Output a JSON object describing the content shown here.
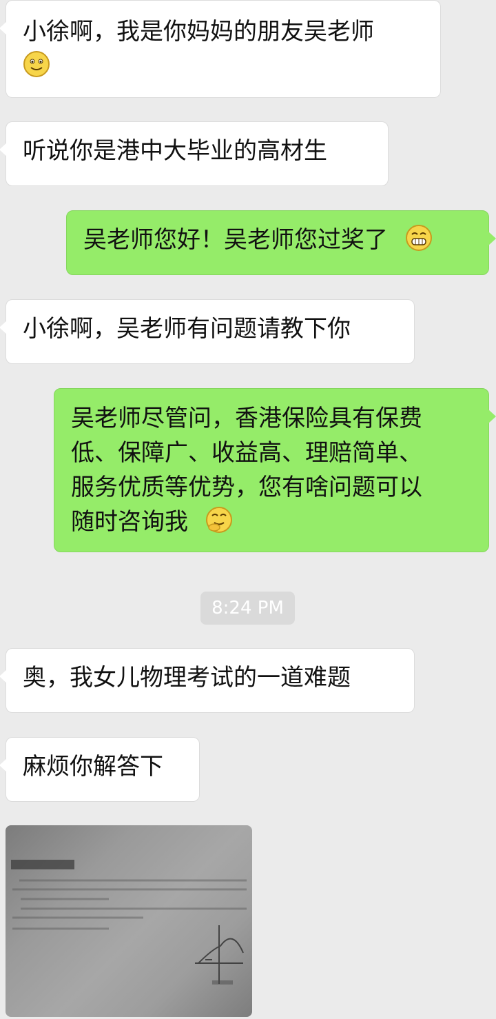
{
  "messages": [
    {
      "side": "left",
      "text": "小徐啊，我是你妈妈的朋友吴老师",
      "emoji": "smile-emoji"
    },
    {
      "side": "left",
      "text": "听说你是港中大毕业的高材生"
    },
    {
      "side": "right",
      "text": "吴老师您好！吴老师您过奖了",
      "emoji": "grin-emoji"
    },
    {
      "side": "left",
      "text": "小徐啊，吴老师有问题请教下你"
    },
    {
      "side": "right",
      "lines": [
        "吴老师尽管问，香港保险具有保费",
        "低、保障广、收益高、理赔简单、",
        "服务优质等优势，您有啥问题可以",
        "随时咨询我"
      ],
      "emoji": "chuckle-emoji"
    },
    {
      "side": "left",
      "text": "奥，我女儿物理考试的一道难题"
    },
    {
      "side": "left",
      "text": "麻烦你解答下"
    }
  ],
  "timestamp": "8:24 PM",
  "photo": {
    "kind": "photo of a physics exam page with a graph"
  },
  "colors": {
    "background": "#ebebeb",
    "left_bubble": "#ffffff",
    "right_bubble": "#95ec69"
  }
}
